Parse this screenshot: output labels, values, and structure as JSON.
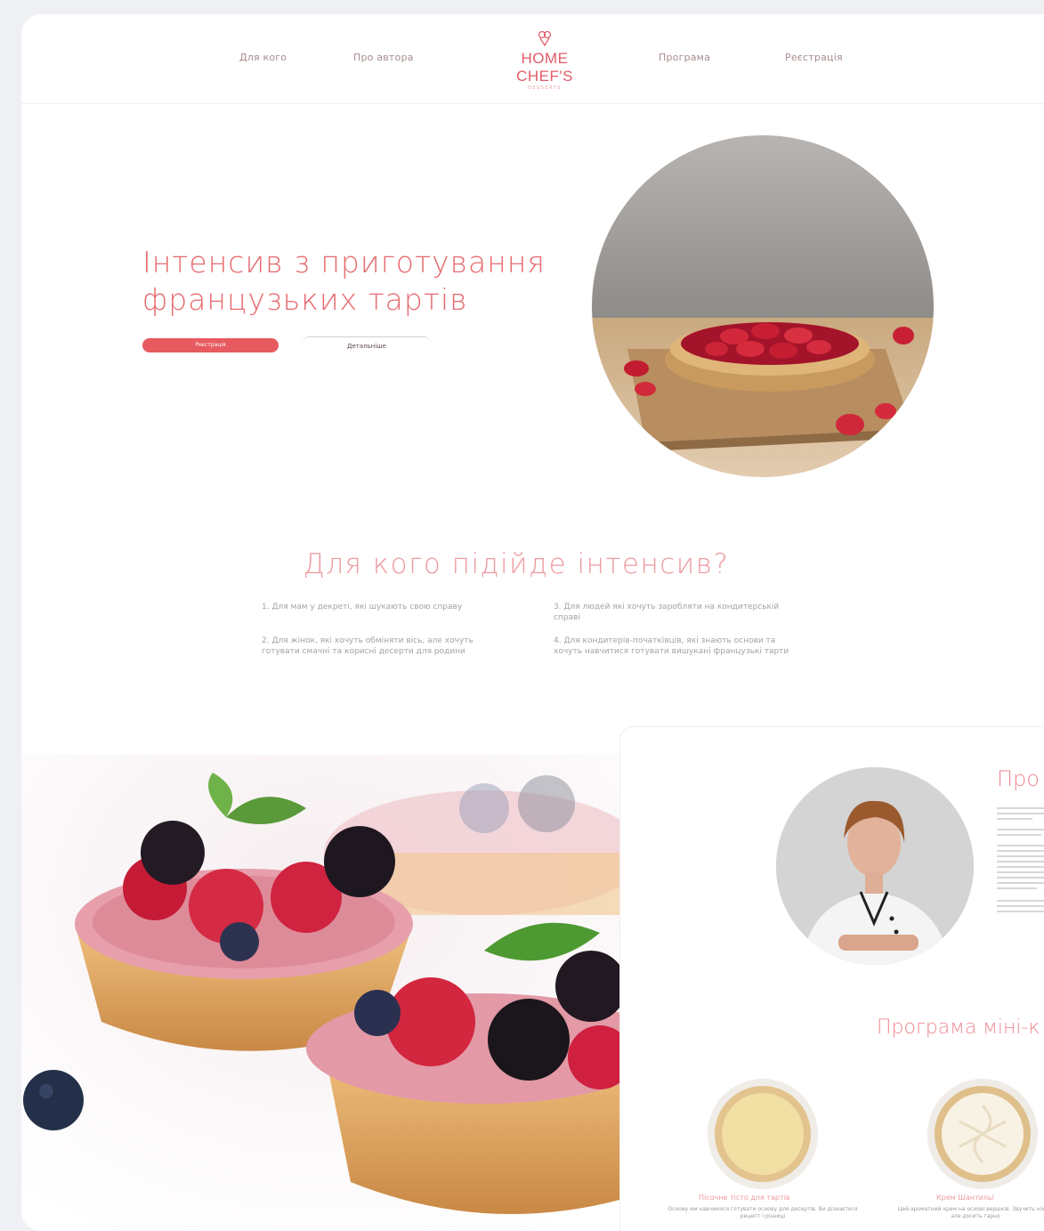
{
  "nav": {
    "items": [
      "Для кого",
      "Про автора",
      "Програма",
      "Реєстрація"
    ],
    "logo_text": "HOME CHEF'S",
    "logo_sub": "DESSERTS"
  },
  "hero": {
    "title": "Інтенсив з приготування французьких тартів",
    "primary_button": "Реєстрація",
    "secondary_button": "Детальніше"
  },
  "who": {
    "title": "Для кого підійде інтенсив?",
    "items": [
      "1. Для мам у декреті, які шукають свою справу",
      "2. Для жінок, які хочуть обміняти вісь, але хочуть готувати смачні та корисні десерти для родини",
      "3. Для людей які хочуть заробляти на кондитерській справі",
      "4. Для кондитерів-початківців, які знають основи та хочуть навчитися готувати вишукані французькі тарти"
    ]
  },
  "about": {
    "title": "Про"
  },
  "program": {
    "title": "Програма міні-к",
    "items": [
      {
        "label": "Пісочне тісто для тартів",
        "desc": "Основу ми навчимося готувати основу для десертів. Ви дізнаєтеся рецепт і різниці"
      },
      {
        "label": "Крем Шантильї",
        "desc": "Цей ароматний крем на основі вершків. Звучить ніжно але досить гарно"
      }
    ]
  },
  "colors": {
    "accent": "#e75a5f",
    "accent_light": "#ee9a9f",
    "background": "#eef0f4"
  }
}
